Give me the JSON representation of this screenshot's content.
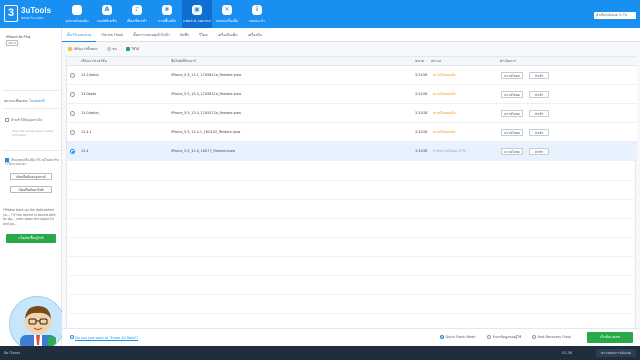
{
  "header": {
    "logo_title": "3uTools",
    "logo_sub": "www.3u.com",
    "logo_mark": "3",
    "nav": [
      {
        "label": "อุปกรณ์ของฉัน",
        "icon": ""
      },
      {
        "label": "แอปพลิเคชั่น",
        "icon": "A"
      },
      {
        "label": "เสียงเรียกเข้า",
        "icon": "♪"
      },
      {
        "label": "ภาพพื้นหลัง",
        "icon": "❀"
      },
      {
        "label": "แฟลช & เจลเบรก",
        "icon": "▣"
      },
      {
        "label": "กล่องเครื่องมือ",
        "icon": "✕"
      },
      {
        "label": "บทแนะนำ",
        "icon": "i"
      }
    ],
    "right_text": "ตัวเลือก/อัปเดต 3.7%"
  },
  "sidebar": {
    "device_name": "iPhone 6s Plus",
    "device_tag": "iOS 0",
    "device_sub": "",
    "status_label": "สถานะเชื่อมต่อ:",
    "status_value": "โหมดปกติ",
    "check1": "ห้ามทำให้ข้อมูลหายไป",
    "note1": "Skip the setup wizard when activated",
    "check2": "เก็บแชทเครื่องมือ iTS ลงในสมาร์ท ไว้ในระบบเวลา",
    "btn1": "เปิดหรือค้นหาอุปกรณ์",
    "btn2": "เปิดหรือค้นหาไฟล์",
    "warning": "*Please back up the data before yo... * If the device is bound with an Ap... note down the Apple ID and pa...",
    "green_btn": "แบ็คอัพ/ฟื้นฟูไฟล์"
  },
  "tabs": [
    "ตั้งเวิร์มแบบง่าย",
    "iTunes Flash",
    "ตั้งค่าระบบเหตุเฝ้าไปถ้า",
    "บันทึก",
    "รีโมต",
    "เครื่องมือเพิ่ม",
    "เครื่องมือ"
  ],
  "filters": [
    {
      "label": "เฟิร์มแวร์ทั้งหมด",
      "color": "#f5c242"
    },
    {
      "label": "ชน",
      "color": "#cfcfcf"
    },
    {
      "label": "ใช้ได้",
      "color": "#27a94a"
    }
  ],
  "table": {
    "headers": [
      "เฟิร์มแวร์เวอร์ชั่น",
      "ชื่อไฟล์เฟิร์มแวร์",
      "ขนาด",
      "สถานะ",
      "ดำเนินการ"
    ],
    "rows": [
      {
        "version": "13.1(beta)",
        "file": "iPhone_5.5_13.1_17A5821e_Restore.ipsw",
        "size": "3.51GB",
        "status": "ดาวน์โหลดแล้ว",
        "status_type": "ok",
        "btn1": "ดาวน์โหลด",
        "btn2": "นำเข้า",
        "selected": false
      },
      {
        "version": "13.0beta",
        "file": "iPhone_5.5_13.0_17A5831e_Restore.ipsw",
        "size": "3.51GB",
        "status": "ดาวน์โหลดแล้ว",
        "status_type": "ok",
        "btn1": "ดาวน์โหลด",
        "btn2": "นำเข้า",
        "selected": false
      },
      {
        "version": "13.0(beta)",
        "file": "iPhone_5.5_13.0_17A5572a_Restore.ipsw",
        "size": "3.51GB",
        "status": "ดาวน์โหลดแล้ว",
        "status_type": "ok",
        "btn1": "ดาวน์โหลด",
        "btn2": "นำเข้า",
        "selected": false
      },
      {
        "version": "12.4.1",
        "file": "iPhone_5.5_12.4.1_16G102_Restore.ipsw",
        "size": "3.32GB",
        "status": "ดาวน์โหลดแล้ว",
        "status_type": "ok",
        "btn1": "ดาวน์โหลด",
        "btn2": "นำเข้า",
        "selected": false
      },
      {
        "version": "12.4",
        "file": "iPhone_5.5_12.4_16G77_Restore.ipsw",
        "size": "3.32GB",
        "status": "กำลังดาวน์โหลด 37%",
        "status_type": "dl",
        "btn1": "ดาวน์โหลด",
        "btn2": "นำเข้า",
        "selected": true
      }
    ]
  },
  "bottom": {
    "link": "Do you just want to \"Erase All Data\"?",
    "modes": [
      {
        "label": "Quick Flash Mode",
        "on": true
      },
      {
        "label": "รักษาข้อมูลของผู้ใช้",
        "on": false
      },
      {
        "label": "Anti-Recovery Flash",
        "on": false
      }
    ],
    "flash_btn": "เริ่มต้นแฟลช"
  },
  "statusbar": {
    "left": "ปิด iTunes",
    "version": "V2.36",
    "right": "ตรวจสอบการอัปเดต"
  }
}
